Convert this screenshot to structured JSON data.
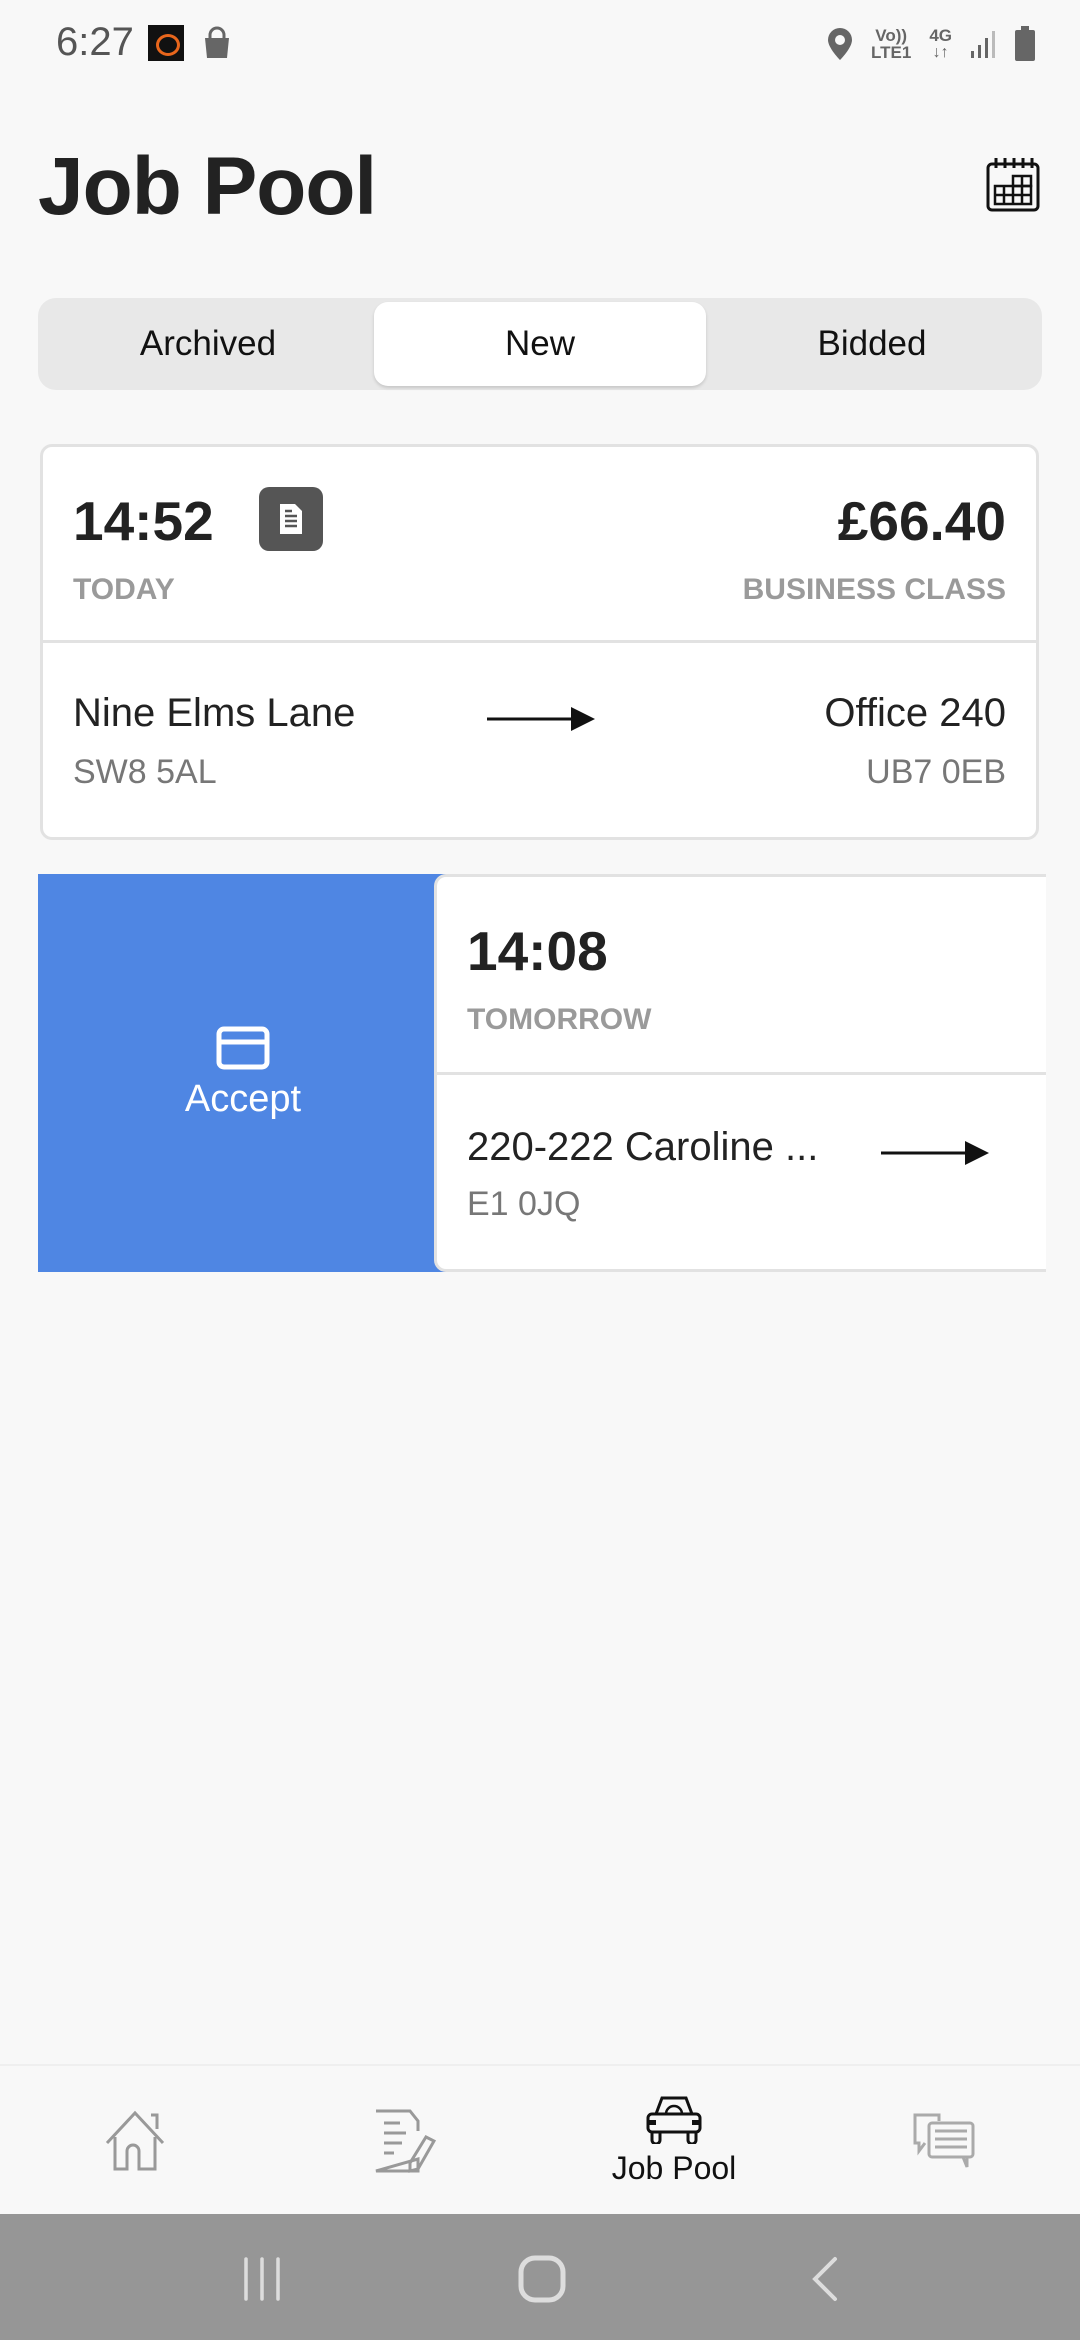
{
  "status_bar": {
    "time": "6:27",
    "network_top": "Vo))",
    "network_bottom": "LTE1",
    "data_type": "4G",
    "icons": [
      "app-notification-icon",
      "shopping-bag-icon",
      "location-icon",
      "volte-icon",
      "4g-data-icon",
      "signal-icon",
      "battery-icon"
    ]
  },
  "header": {
    "title": "Job Pool",
    "calendar_icon": "calendar-icon"
  },
  "tabs": [
    {
      "label": "Archived",
      "active": false
    },
    {
      "label": "New",
      "active": true
    },
    {
      "label": "Bidded",
      "active": false
    }
  ],
  "jobs": [
    {
      "time": "14:52",
      "day": "TODAY",
      "has_document": true,
      "price": "£66.40",
      "class": "BUSINESS CLASS",
      "from": {
        "name": "Nine Elms Lane",
        "postcode": "SW8 5AL"
      },
      "to": {
        "name": "Office 240",
        "postcode": "UB7 0EB"
      }
    },
    {
      "time": "14:08",
      "day": "TOMORROW",
      "from": {
        "name": "220-222 Caroline ...",
        "postcode": "E1 0JQ"
      },
      "swipe_action": {
        "label": "Accept",
        "icon": "card-icon",
        "color": "#4f86e3"
      }
    }
  ],
  "bottom_nav": [
    {
      "icon": "home-icon",
      "label": "",
      "active": false
    },
    {
      "icon": "document-edit-icon",
      "label": "",
      "active": false
    },
    {
      "icon": "car-icon",
      "label": "Job Pool",
      "active": true
    },
    {
      "icon": "chat-icon",
      "label": "",
      "active": false
    }
  ],
  "system_nav": [
    "recent-apps",
    "home",
    "back"
  ]
}
